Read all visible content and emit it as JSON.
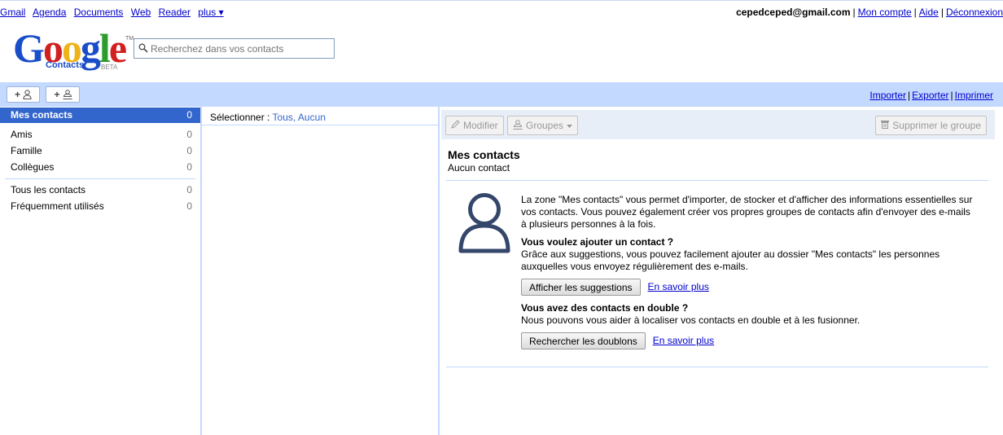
{
  "topnav": {
    "links": [
      "Gmail",
      "Agenda",
      "Documents",
      "Web",
      "Reader"
    ],
    "more_label": "plus ▾",
    "email": "cepedceped@gmail.com",
    "account": "Mon compte",
    "help": "Aide",
    "logout": "Déconnexion"
  },
  "logo": {
    "letters": [
      "G",
      "o",
      "o",
      "g",
      "l",
      "e"
    ],
    "product": "Contacts",
    "beta": "BETA",
    "tm": "TM"
  },
  "search": {
    "placeholder": "Recherchez dans vos contacts",
    "value": ""
  },
  "toolbar": {
    "add_contact": "+",
    "add_group": "+",
    "import": "Importer",
    "export": "Exporter",
    "print": "Imprimer"
  },
  "groups": {
    "my_contacts": {
      "label": "Mes contacts",
      "count": "0"
    },
    "custom": [
      {
        "label": "Amis",
        "count": "0"
      },
      {
        "label": "Famille",
        "count": "0"
      },
      {
        "label": "Collègues",
        "count": "0"
      }
    ],
    "system": [
      {
        "label": "Tous les contacts",
        "count": "0"
      },
      {
        "label": "Fréquemment utilisés",
        "count": "0"
      }
    ]
  },
  "selection": {
    "label": "Sélectionner :",
    "all": "Tous",
    "none": "Aucun"
  },
  "details": {
    "edit": "Modifier",
    "groups": "Groupes",
    "delete_group": "Supprimer le groupe",
    "title": "Mes contacts",
    "subtitle": "Aucun contact",
    "intro": "La zone \"Mes contacts\" vous permet d'importer, de stocker et d'afficher des informations essentielles sur vos contacts. Vous pouvez également créer vos propres groupes de contacts afin d'envoyer des e-mails à plusieurs personnes à la fois.",
    "add_heading": "Vous voulez ajouter un contact ?",
    "add_text": "Grâce aux suggestions, vous pouvez facilement ajouter au dossier \"Mes contacts\" les personnes auxquelles vous envoyez régulièrement des e-mails.",
    "suggest_button": "Afficher les suggestions",
    "learn_more_1": "En savoir plus",
    "dup_heading": "Vous avez des contacts en double ?",
    "dup_text": "Nous pouvons vous aider à localiser vos contacts en double et à les fusionner.",
    "dup_button": "Rechercher les doublons",
    "learn_more_2": "En savoir plus"
  },
  "colors": {
    "toolbar_bg": "#c3d9ff",
    "selected_group": "#3366cc",
    "link": "#0000cc",
    "avatar": "#34466a"
  },
  "icons": [
    "search-icon",
    "person-add-icon",
    "group-add-icon",
    "pencil-icon",
    "group-icon",
    "dropdown-arrow-icon",
    "trash-icon",
    "avatar-icon"
  ]
}
